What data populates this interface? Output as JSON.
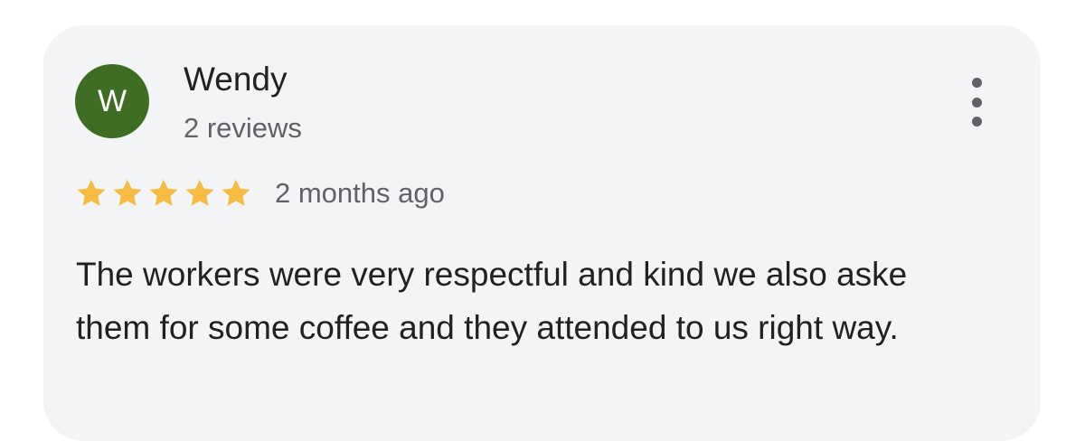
{
  "review": {
    "author_initial": "W",
    "author_name": "Wendy",
    "author_reviews": "2 reviews",
    "avatar_color": "#3f6d23",
    "rating": 5,
    "rating_max": 5,
    "star_color": "#f6bb42",
    "date": "2 months ago",
    "text": "The workers were very respectful and kind we also aske them for some coffee and they attended to us right way.",
    "more_icon": "more-vertical-icon"
  }
}
